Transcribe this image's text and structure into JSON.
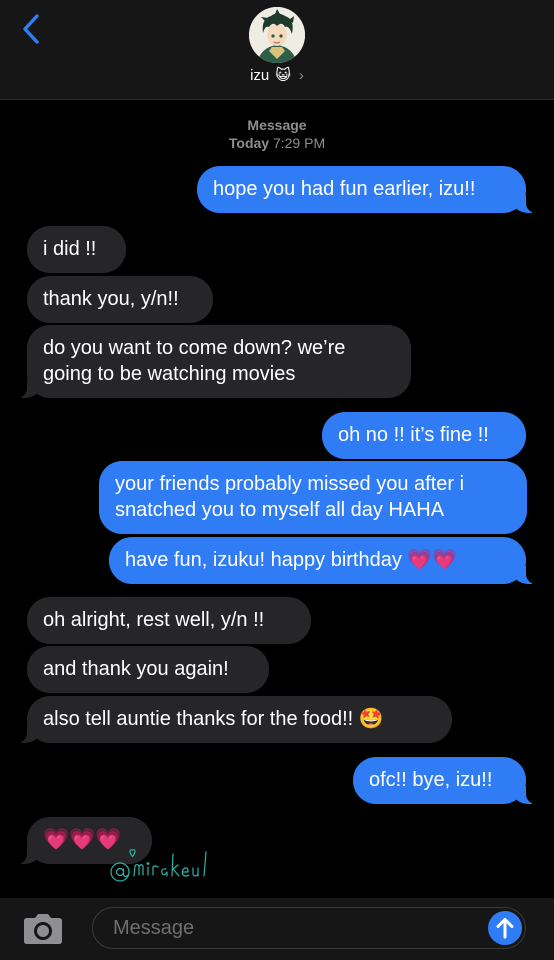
{
  "header": {
    "contact_name": "izu",
    "contact_emoji": "😺",
    "chevron": "›",
    "back_icon": "chevron-left-icon"
  },
  "meta": {
    "service": "Message",
    "day": "Today",
    "time": "7:29 PM"
  },
  "messages": [
    {
      "direction": "out",
      "text": "hope you had fun earlier, izu!!"
    },
    {
      "direction": "in",
      "text": "i did !!"
    },
    {
      "direction": "in",
      "text": "thank you, y/n!!"
    },
    {
      "direction": "in",
      "text": "do you want to come down? we’re going to be watching movies"
    },
    {
      "direction": "out",
      "text": "oh no !! it’s fine !!"
    },
    {
      "direction": "out",
      "text": "your friends probably missed you after i snatched you to myself all day HAHA"
    },
    {
      "direction": "out",
      "text": "have fun, izuku! happy birthday 💗💗"
    },
    {
      "direction": "in",
      "text": "oh alright, rest well, y/n !!"
    },
    {
      "direction": "in",
      "text": "and thank you again!"
    },
    {
      "direction": "in",
      "text": "also tell auntie thanks for the food!! 🤩"
    },
    {
      "direction": "out",
      "text": "ofc!! bye, izu!!"
    },
    {
      "direction": "in",
      "text": "💗💗💗"
    }
  ],
  "watermark": "@mirakeul",
  "composer": {
    "placeholder": "Message",
    "camera_icon": "camera-icon",
    "send_icon": "arrow-up-icon"
  },
  "colors": {
    "outgoing_bubble": "#2f7cf5",
    "incoming_bubble": "#262628",
    "background": "#000000",
    "bar_background": "#161616"
  }
}
